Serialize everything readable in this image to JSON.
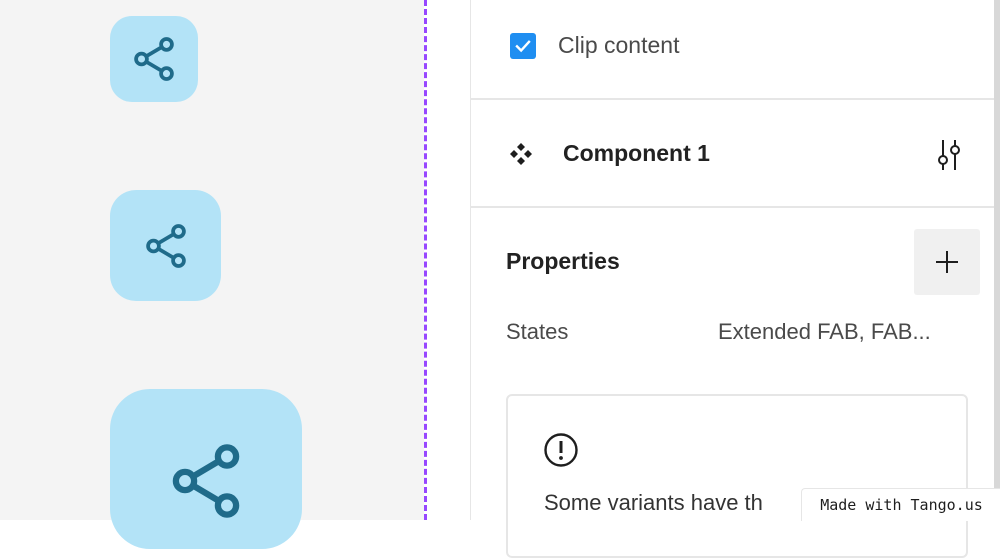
{
  "canvas": {
    "fab_color": "#b3e3f7",
    "icon_color": "#1f6b8a",
    "frame_border_color": "#9747ff",
    "variants": [
      {
        "name": "fab-small",
        "icon": "share-icon"
      },
      {
        "name": "fab-medium",
        "icon": "share-icon"
      },
      {
        "name": "fab-large",
        "icon": "share-icon"
      }
    ]
  },
  "panel": {
    "clip_content": {
      "checked": true,
      "label": "Clip content"
    },
    "component": {
      "icon": "component-set-icon",
      "name": "Component 1",
      "settings_icon": "tune-icon"
    },
    "properties": {
      "title": "Properties",
      "add_icon": "plus-icon",
      "items": [
        {
          "name": "States",
          "value": "Extended FAB, FAB..."
        }
      ]
    },
    "warning": {
      "icon": "alert-circle-icon",
      "text": "Some variants have th"
    }
  },
  "watermark": {
    "text": "Made with Tango.us"
  },
  "colors": {
    "accent": "#1f8ef1",
    "divider": "#e6e6e6"
  }
}
